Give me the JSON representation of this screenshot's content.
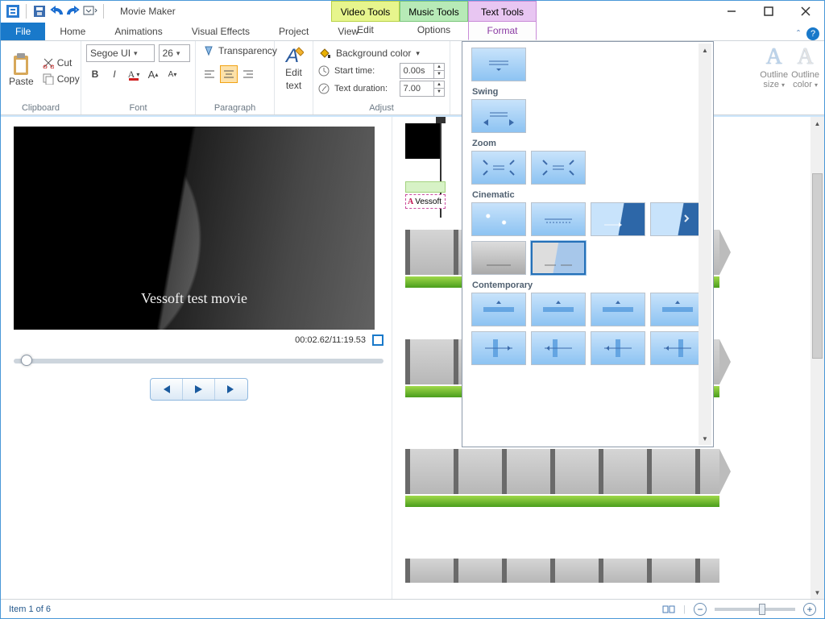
{
  "titlebar": {
    "app_title": "Movie Maker"
  },
  "tool_tabs": {
    "video": "Video Tools",
    "music": "Music Tools",
    "text": "Text Tools"
  },
  "tabs": {
    "file": "File",
    "home": "Home",
    "animations": "Animations",
    "visual_effects": "Visual Effects",
    "project": "Project",
    "view": "View",
    "edit": "Edit",
    "options": "Options",
    "format": "Format"
  },
  "ribbon": {
    "clipboard": {
      "paste": "Paste",
      "cut": "Cut",
      "copy": "Copy",
      "label": "Clipboard"
    },
    "font": {
      "family": "Segoe UI",
      "size": "26",
      "label": "Font"
    },
    "paragraph": {
      "transparency": "Transparency",
      "label": "Paragraph"
    },
    "edit_text": {
      "label_top": "Edit",
      "label_bot": "text"
    },
    "adjust": {
      "bgcolor": "Background color",
      "start": "Start time:",
      "start_val": "0.00s",
      "duration": "Text duration:",
      "duration_val": "7.00",
      "label": "Adjust"
    },
    "outline": {
      "size": "Outline",
      "size2": "size",
      "color": "Outline",
      "color2": "color"
    }
  },
  "effects": {
    "cat_swing": "Swing",
    "cat_zoom": "Zoom",
    "cat_cinematic": "Cinematic",
    "cat_contemporary": "Contemporary"
  },
  "preview": {
    "caption": "Vessoft test movie",
    "time": "00:02.62/11:19.53"
  },
  "title_clip_text": "Vessoft",
  "statusbar": {
    "item": "Item 1 of 6"
  }
}
